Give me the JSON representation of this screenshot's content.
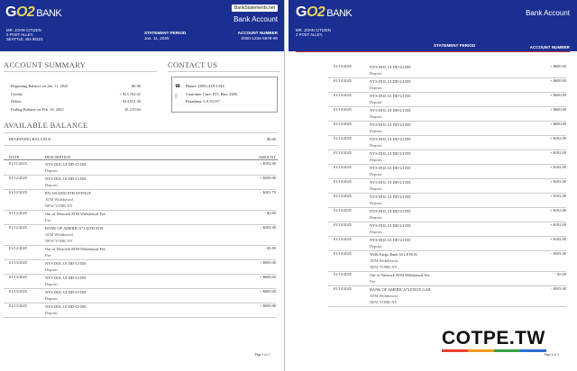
{
  "bank": {
    "brand_main": "G",
    "brand_two": "O2",
    "brand_word": "BANK",
    "site_badge": "BankStatements.net",
    "doc_title": "Bank Account"
  },
  "holder": {
    "name": "MR. JOHN CITIZEN",
    "address1": "2 POST ALLEY,",
    "address2": "SEATTLE, WA 98101"
  },
  "statement": {
    "period_label": "STATEMENT PERIOD",
    "period_value": "Jan. 11, 2025",
    "account_label": "ACCOUNT NUMBER",
    "account_value": "0000-1234-5678-90"
  },
  "summary": {
    "title": "ACCOUNT SUMMARY",
    "rows": [
      {
        "label": "Beginning Balance on Jan. 11, 2025",
        "value": "$0.00"
      },
      {
        "label": "Credits",
        "value": "+ $15,762.02"
      },
      {
        "label": "Debits",
        "value": "- $14,551.38"
      },
      {
        "label": "Ending Balance on Feb. 10, 2025",
        "value": "$1,210.64"
      }
    ]
  },
  "contact": {
    "title": "CONTACT US",
    "phone": "Phone: (855) 418-1334",
    "care": "Customer Care, P.O. Box 3100,",
    "city": "Pasadena, CA 91117"
  },
  "available": {
    "title": "AVAILABLE BALANCE",
    "beginning_label": "BEGINNING BALANCE",
    "beginning_value": "$0.00"
  },
  "columns": {
    "date": "DATE",
    "description": "DESCRIPTION",
    "amount": "AMOUNT"
  },
  "transactions_p1": [
    {
      "date": "01/11/2025",
      "line1": "NYS DOL UI DD-UI DD",
      "line2": "Deposit",
      "line3": "",
      "amount": "+ $182.00"
    },
    {
      "date": "01/12/2025",
      "line1": "NYS DOL UI DD-UI DD",
      "line2": "Deposit",
      "line3": "",
      "amount": "+ $500.00"
    },
    {
      "date": "01/12/2025",
      "line1": "PAI ISO2350 8TH AVENUE",
      "line2": "ATM Withdrawal",
      "line3": "NEW YORK NY",
      "amount": "- $201.79"
    },
    {
      "date": "01/12/2025",
      "line1": "Out of Network ATM Withdrawal Fee",
      "line2": "Fee",
      "line3": "",
      "amount": "- $3.00"
    },
    {
      "date": "01/12/2025",
      "line1": "BANK OF AMERICA*145TH STR",
      "line2": "ATM Withdrawal",
      "line3": "NEW YORK NY",
      "amount": "- $203.00"
    },
    {
      "date": "01/12/2025",
      "line1": "Out of Network ATM Withdrawal Fee",
      "line2": "Fee",
      "line3": "",
      "amount": "- $3.00"
    },
    {
      "date": "01/13/2025",
      "line1": "NYS DOL UI DD-UI DD",
      "line2": "Deposit",
      "line3": "",
      "amount": "+ $600.00"
    },
    {
      "date": "01/13/2025",
      "line1": "NYS DOL UI DD-UI DD",
      "line2": "Deposit",
      "line3": "",
      "amount": "+ $600.00"
    },
    {
      "date": "01/13/2025",
      "line1": "NYS DOL UI DD-UI DD",
      "line2": "Deposit",
      "line3": "",
      "amount": "+ $600.00"
    },
    {
      "date": "01/13/2025",
      "line1": "NYS DOL UI DD-UI DD",
      "line2": "Deposit",
      "line3": "",
      "amount": "+ $600.00"
    }
  ],
  "transactions_p2": [
    {
      "date": "01/13/2025",
      "line1": "NYS DOL UI DD-UI DD",
      "line2": "Deposit",
      "line3": "",
      "amount": "+ $600.00"
    },
    {
      "date": "01/13/2025",
      "line1": "NYS DOL UI DD-UI DD",
      "line2": "Deposit",
      "line3": "",
      "amount": "+ $600.00"
    },
    {
      "date": "01/13/2025",
      "line1": "NYS DOL UI DD-UI DD",
      "line2": "Deposit",
      "line3": "",
      "amount": "+ $600.00"
    },
    {
      "date": "01/13/2025",
      "line1": "NYS DOL UI DD-UI DD",
      "line2": "Deposit",
      "line3": "",
      "amount": "+ $600.00"
    },
    {
      "date": "01/13/2025",
      "line1": "NYS DOL UI DD-UI DD",
      "line2": "Deposit",
      "line3": "",
      "amount": "+ $600.00"
    },
    {
      "date": "01/13/2025",
      "line1": "NYS DOL UI DD-UI DD",
      "line2": "Deposit",
      "line3": "",
      "amount": "+ $182.00"
    },
    {
      "date": "01/13/2025",
      "line1": "NYS DOL UI DD-UI DD",
      "line2": "Deposit",
      "line3": "",
      "amount": "+ $182.00"
    },
    {
      "date": "01/13/2025",
      "line1": "NYS DOL UI DD-UI DD",
      "line2": "Deposit",
      "line3": "",
      "amount": "+ $182.00"
    },
    {
      "date": "01/13/2025",
      "line1": "NYS DOL UI DD-UI DD",
      "line2": "Deposit",
      "line3": "",
      "amount": "+ $182.00"
    },
    {
      "date": "01/13/2025",
      "line1": "NYS DOL UI DD-UI DD",
      "line2": "Deposit",
      "line3": "",
      "amount": "+ $182.00"
    },
    {
      "date": "01/13/2025",
      "line1": "NYS DOL UI DD-UI DD",
      "line2": "Deposit",
      "line3": "",
      "amount": "+ $182.00"
    },
    {
      "date": "01/13/2025",
      "line1": "NYS DOL UI DD-UI DD",
      "line2": "Deposit",
      "line3": "",
      "amount": "+ $182.00"
    },
    {
      "date": "01/13/2025",
      "line1": "NYS DOL UI DD-UI DD",
      "line2": "Deposit",
      "line3": "",
      "amount": "+ $182.00"
    },
    {
      "date": "01/13/2025",
      "line1": "Wells Fargo Bank 63 LENOX",
      "line2": "ATM Withdrawal",
      "line3": "NEW YORK NY",
      "amount": "- $503.00"
    },
    {
      "date": "01/13/2025",
      "line1": "Out of Network ATM Withdrawal Fee",
      "line2": "Fee",
      "line3": "",
      "amount": "- $3.00"
    },
    {
      "date": "01/13/2025",
      "line1": "BANK OF AMERICA*LENOX GAR",
      "line2": "ATM Withdrawal",
      "line3": "NEW YORK NY",
      "amount": "- $503.00"
    }
  ],
  "footer": {
    "page1": "Page 1 of 2",
    "page2": "Page 2 of 2"
  },
  "watermark": {
    "text": "COTPE.TW",
    "colors": [
      "#e8412c",
      "#f29a1d",
      "#3aa14a",
      "#2c6fd6"
    ]
  },
  "colors": {
    "banner": "#1a2f91",
    "accent": "#e8d35a"
  }
}
